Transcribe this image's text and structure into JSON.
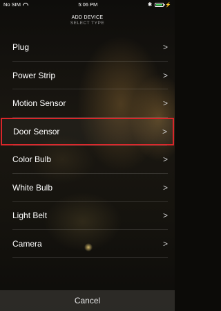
{
  "status": {
    "carrier": "No SIM",
    "time": "5:06 PM",
    "bluetooth": "✱"
  },
  "header": {
    "title": "ADD DEVICE",
    "subtitle": "SELECT TYPE"
  },
  "device_types": [
    {
      "label": "Plug"
    },
    {
      "label": "Power Strip"
    },
    {
      "label": "Motion Sensor"
    },
    {
      "label": "Door Sensor"
    },
    {
      "label": "Color Bulb"
    },
    {
      "label": "White Bulb"
    },
    {
      "label": "Light Belt"
    },
    {
      "label": "Camera"
    }
  ],
  "chevron": ">",
  "cancel_label": "Cancel",
  "colors": {
    "highlight": "#d9262a",
    "battery": "#4cd964"
  }
}
